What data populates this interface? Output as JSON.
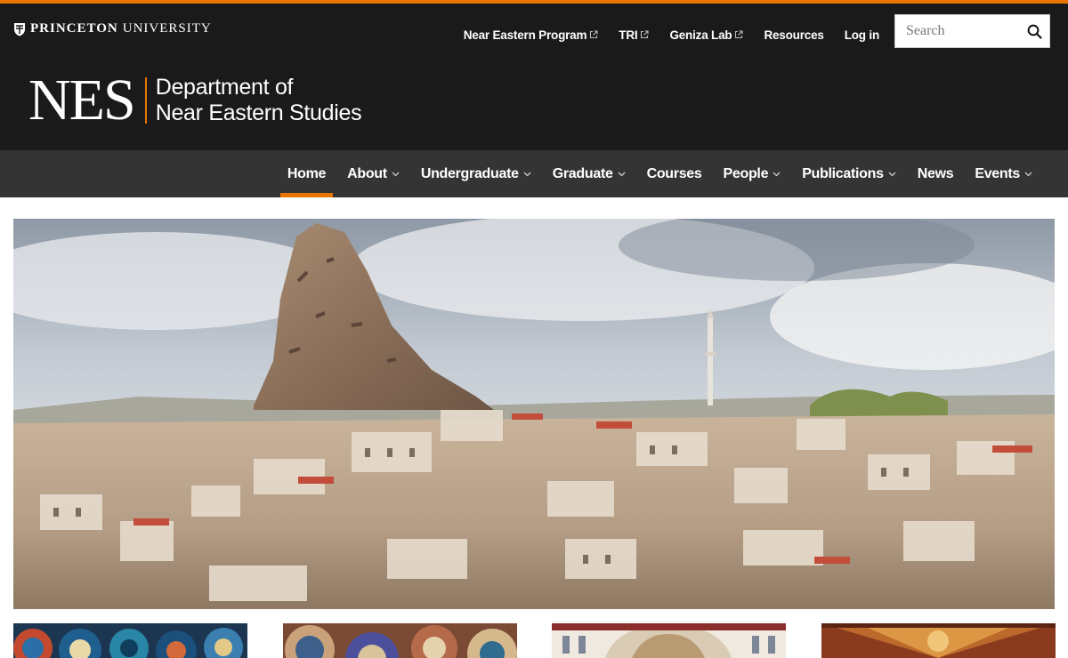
{
  "header": {
    "university": {
      "bold": "PRINCETON",
      "light": "UNIVERSITY"
    },
    "utility_links": [
      {
        "label": "Near Eastern Program",
        "external": true
      },
      {
        "label": "TRI",
        "external": true
      },
      {
        "label": "Geniza Lab",
        "external": true
      },
      {
        "label": "Resources",
        "external": false
      },
      {
        "label": "Log in",
        "external": false
      }
    ],
    "search": {
      "placeholder": "Search"
    },
    "logo": {
      "mark": "NES",
      "line1": "Department of",
      "line2": "Near Eastern Studies"
    }
  },
  "nav": {
    "items": [
      {
        "label": "Home",
        "active": true,
        "dropdown": false
      },
      {
        "label": "About",
        "dropdown": true
      },
      {
        "label": "Undergraduate",
        "dropdown": true
      },
      {
        "label": "Graduate",
        "dropdown": true
      },
      {
        "label": "Courses",
        "dropdown": false
      },
      {
        "label": "People",
        "dropdown": true
      },
      {
        "label": "Publications",
        "dropdown": true
      },
      {
        "label": "News",
        "dropdown": false
      },
      {
        "label": "Events",
        "dropdown": true
      }
    ]
  },
  "colors": {
    "accent": "#e77500",
    "masthead": "#1a1a1a",
    "nav_bar": "#343434"
  },
  "icons": {
    "shield": "shield-icon",
    "external": "external-link-icon",
    "search": "search-icon",
    "chevron": "chevron-down-icon"
  }
}
